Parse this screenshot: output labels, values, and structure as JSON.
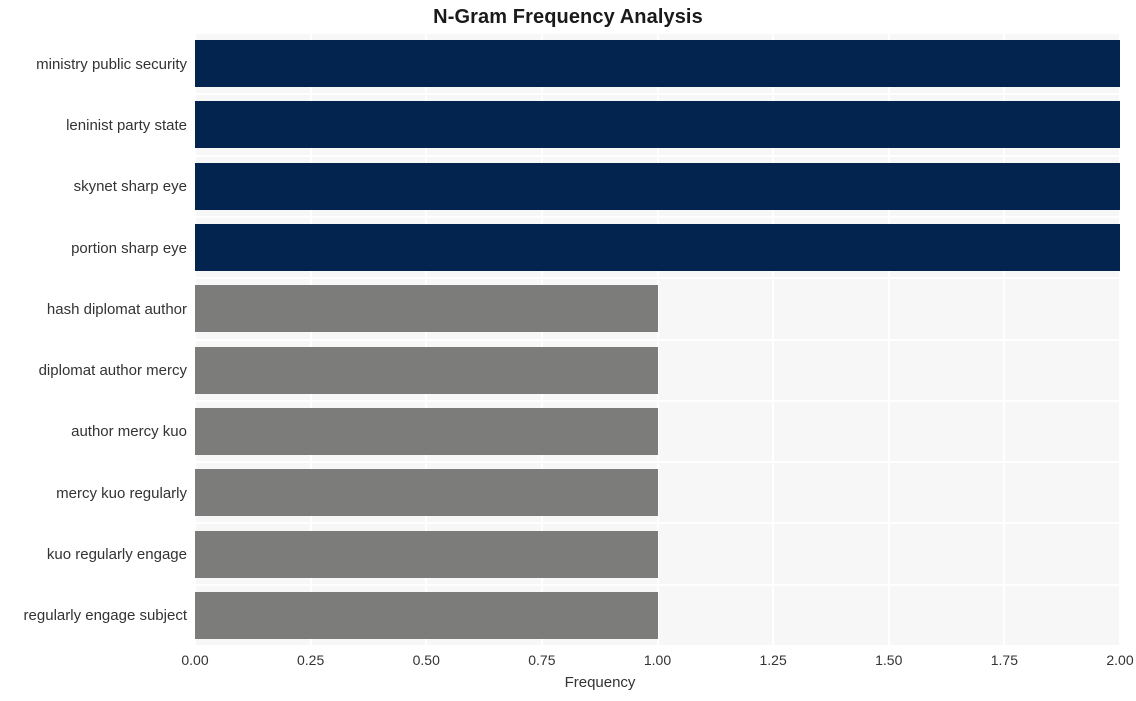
{
  "chart_data": {
    "type": "bar",
    "orientation": "horizontal",
    "title": "N-Gram Frequency Analysis",
    "xlabel": "Frequency",
    "ylabel": "",
    "xlim": [
      0.0,
      2.0
    ],
    "xticks": [
      "0.00",
      "0.25",
      "0.50",
      "0.75",
      "1.00",
      "1.25",
      "1.50",
      "1.75",
      "2.00"
    ],
    "xtick_values": [
      0.0,
      0.25,
      0.5,
      0.75,
      1.0,
      1.25,
      1.5,
      1.75,
      2.0
    ],
    "grid": true,
    "legend": "none",
    "categories": [
      "ministry public security",
      "leninist party state",
      "skynet sharp eye",
      "portion sharp eye",
      "hash diplomat author",
      "diplomat author mercy",
      "author mercy kuo",
      "mercy kuo regularly",
      "kuo regularly engage",
      "regularly engage subject"
    ],
    "values": [
      2,
      2,
      2,
      2,
      1,
      1,
      1,
      1,
      1,
      1
    ],
    "bar_colors": [
      "#042450",
      "#042450",
      "#042450",
      "#042450",
      "#7c7c7a",
      "#7c7c7a",
      "#7c7c7a",
      "#7c7c7a",
      "#7c7c7a",
      "#7c7c7a"
    ]
  },
  "style": {
    "plot_background": "#f7f7f7",
    "figure_background": "#ffffff",
    "gridline_color": "#ffffff",
    "text_color": "#333333",
    "title_color": "#1a1a1a",
    "high_value_color": "#042450",
    "low_value_color": "#7c7c7a"
  }
}
